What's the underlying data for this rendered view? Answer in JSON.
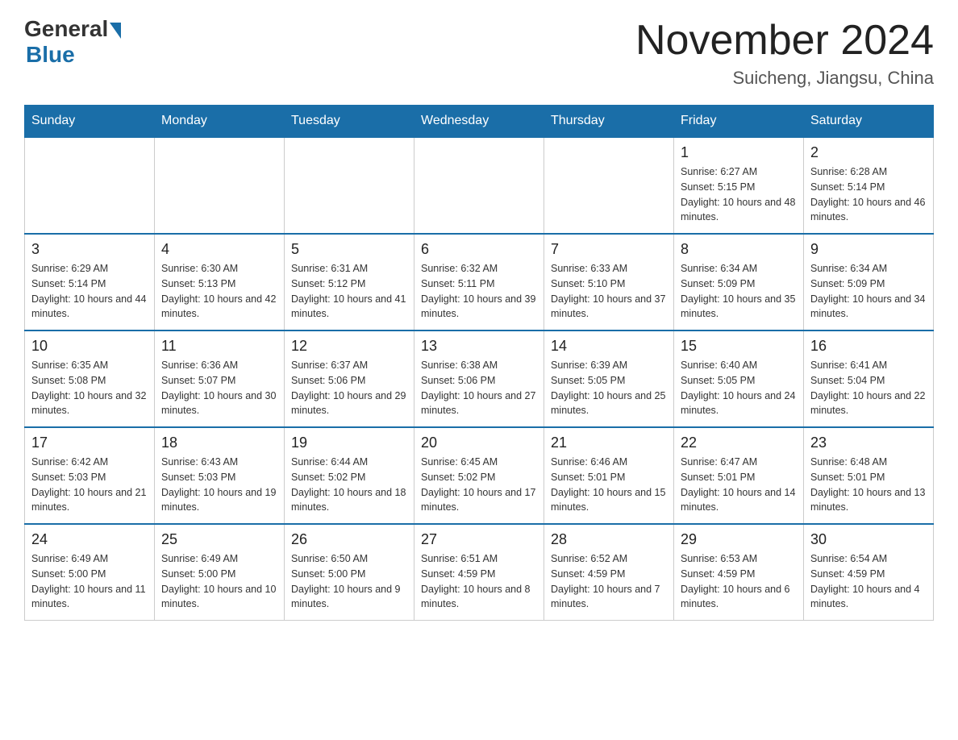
{
  "header": {
    "logo_general": "General",
    "logo_blue": "Blue",
    "month_title": "November 2024",
    "location": "Suicheng, Jiangsu, China"
  },
  "weekdays": [
    "Sunday",
    "Monday",
    "Tuesday",
    "Wednesday",
    "Thursday",
    "Friday",
    "Saturday"
  ],
  "weeks": [
    [
      {
        "day": "",
        "sunrise": "",
        "sunset": "",
        "daylight": ""
      },
      {
        "day": "",
        "sunrise": "",
        "sunset": "",
        "daylight": ""
      },
      {
        "day": "",
        "sunrise": "",
        "sunset": "",
        "daylight": ""
      },
      {
        "day": "",
        "sunrise": "",
        "sunset": "",
        "daylight": ""
      },
      {
        "day": "",
        "sunrise": "",
        "sunset": "",
        "daylight": ""
      },
      {
        "day": "1",
        "sunrise": "Sunrise: 6:27 AM",
        "sunset": "Sunset: 5:15 PM",
        "daylight": "Daylight: 10 hours and 48 minutes."
      },
      {
        "day": "2",
        "sunrise": "Sunrise: 6:28 AM",
        "sunset": "Sunset: 5:14 PM",
        "daylight": "Daylight: 10 hours and 46 minutes."
      }
    ],
    [
      {
        "day": "3",
        "sunrise": "Sunrise: 6:29 AM",
        "sunset": "Sunset: 5:14 PM",
        "daylight": "Daylight: 10 hours and 44 minutes."
      },
      {
        "day": "4",
        "sunrise": "Sunrise: 6:30 AM",
        "sunset": "Sunset: 5:13 PM",
        "daylight": "Daylight: 10 hours and 42 minutes."
      },
      {
        "day": "5",
        "sunrise": "Sunrise: 6:31 AM",
        "sunset": "Sunset: 5:12 PM",
        "daylight": "Daylight: 10 hours and 41 minutes."
      },
      {
        "day": "6",
        "sunrise": "Sunrise: 6:32 AM",
        "sunset": "Sunset: 5:11 PM",
        "daylight": "Daylight: 10 hours and 39 minutes."
      },
      {
        "day": "7",
        "sunrise": "Sunrise: 6:33 AM",
        "sunset": "Sunset: 5:10 PM",
        "daylight": "Daylight: 10 hours and 37 minutes."
      },
      {
        "day": "8",
        "sunrise": "Sunrise: 6:34 AM",
        "sunset": "Sunset: 5:09 PM",
        "daylight": "Daylight: 10 hours and 35 minutes."
      },
      {
        "day": "9",
        "sunrise": "Sunrise: 6:34 AM",
        "sunset": "Sunset: 5:09 PM",
        "daylight": "Daylight: 10 hours and 34 minutes."
      }
    ],
    [
      {
        "day": "10",
        "sunrise": "Sunrise: 6:35 AM",
        "sunset": "Sunset: 5:08 PM",
        "daylight": "Daylight: 10 hours and 32 minutes."
      },
      {
        "day": "11",
        "sunrise": "Sunrise: 6:36 AM",
        "sunset": "Sunset: 5:07 PM",
        "daylight": "Daylight: 10 hours and 30 minutes."
      },
      {
        "day": "12",
        "sunrise": "Sunrise: 6:37 AM",
        "sunset": "Sunset: 5:06 PM",
        "daylight": "Daylight: 10 hours and 29 minutes."
      },
      {
        "day": "13",
        "sunrise": "Sunrise: 6:38 AM",
        "sunset": "Sunset: 5:06 PM",
        "daylight": "Daylight: 10 hours and 27 minutes."
      },
      {
        "day": "14",
        "sunrise": "Sunrise: 6:39 AM",
        "sunset": "Sunset: 5:05 PM",
        "daylight": "Daylight: 10 hours and 25 minutes."
      },
      {
        "day": "15",
        "sunrise": "Sunrise: 6:40 AM",
        "sunset": "Sunset: 5:05 PM",
        "daylight": "Daylight: 10 hours and 24 minutes."
      },
      {
        "day": "16",
        "sunrise": "Sunrise: 6:41 AM",
        "sunset": "Sunset: 5:04 PM",
        "daylight": "Daylight: 10 hours and 22 minutes."
      }
    ],
    [
      {
        "day": "17",
        "sunrise": "Sunrise: 6:42 AM",
        "sunset": "Sunset: 5:03 PM",
        "daylight": "Daylight: 10 hours and 21 minutes."
      },
      {
        "day": "18",
        "sunrise": "Sunrise: 6:43 AM",
        "sunset": "Sunset: 5:03 PM",
        "daylight": "Daylight: 10 hours and 19 minutes."
      },
      {
        "day": "19",
        "sunrise": "Sunrise: 6:44 AM",
        "sunset": "Sunset: 5:02 PM",
        "daylight": "Daylight: 10 hours and 18 minutes."
      },
      {
        "day": "20",
        "sunrise": "Sunrise: 6:45 AM",
        "sunset": "Sunset: 5:02 PM",
        "daylight": "Daylight: 10 hours and 17 minutes."
      },
      {
        "day": "21",
        "sunrise": "Sunrise: 6:46 AM",
        "sunset": "Sunset: 5:01 PM",
        "daylight": "Daylight: 10 hours and 15 minutes."
      },
      {
        "day": "22",
        "sunrise": "Sunrise: 6:47 AM",
        "sunset": "Sunset: 5:01 PM",
        "daylight": "Daylight: 10 hours and 14 minutes."
      },
      {
        "day": "23",
        "sunrise": "Sunrise: 6:48 AM",
        "sunset": "Sunset: 5:01 PM",
        "daylight": "Daylight: 10 hours and 13 minutes."
      }
    ],
    [
      {
        "day": "24",
        "sunrise": "Sunrise: 6:49 AM",
        "sunset": "Sunset: 5:00 PM",
        "daylight": "Daylight: 10 hours and 11 minutes."
      },
      {
        "day": "25",
        "sunrise": "Sunrise: 6:49 AM",
        "sunset": "Sunset: 5:00 PM",
        "daylight": "Daylight: 10 hours and 10 minutes."
      },
      {
        "day": "26",
        "sunrise": "Sunrise: 6:50 AM",
        "sunset": "Sunset: 5:00 PM",
        "daylight": "Daylight: 10 hours and 9 minutes."
      },
      {
        "day": "27",
        "sunrise": "Sunrise: 6:51 AM",
        "sunset": "Sunset: 4:59 PM",
        "daylight": "Daylight: 10 hours and 8 minutes."
      },
      {
        "day": "28",
        "sunrise": "Sunrise: 6:52 AM",
        "sunset": "Sunset: 4:59 PM",
        "daylight": "Daylight: 10 hours and 7 minutes."
      },
      {
        "day": "29",
        "sunrise": "Sunrise: 6:53 AM",
        "sunset": "Sunset: 4:59 PM",
        "daylight": "Daylight: 10 hours and 6 minutes."
      },
      {
        "day": "30",
        "sunrise": "Sunrise: 6:54 AM",
        "sunset": "Sunset: 4:59 PM",
        "daylight": "Daylight: 10 hours and 4 minutes."
      }
    ]
  ]
}
